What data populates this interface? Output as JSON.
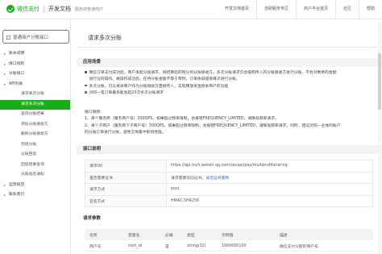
{
  "header": {
    "logo_text": "微信支付",
    "doc_title": "开发文档",
    "sub_title": "服务商普通商户",
    "nav": [
      "开发文档首页",
      "自助服务专区",
      "商户平台首页",
      "社区",
      "帮助"
    ]
  },
  "sidebar": {
    "title": "普通商户分账接口",
    "items": [
      {
        "label": "账本说明",
        "arrow": "▸",
        "level": 1
      },
      {
        "label": "接口规则",
        "arrow": "▸",
        "level": 1
      },
      {
        "label": "分账接口",
        "arrow": "▸",
        "level": 1
      },
      {
        "label": "API列表",
        "arrow": "▾",
        "level": 1
      },
      {
        "label": "请求单次分账",
        "level": 2
      },
      {
        "label": "请求多次分账",
        "level": 2,
        "active": true
      },
      {
        "label": "查询分账结果",
        "level": 2
      },
      {
        "label": "添加分账接收方",
        "level": 2
      },
      {
        "label": "删除分账接收方",
        "level": 2
      },
      {
        "label": "完结分账",
        "level": 2
      },
      {
        "label": "分账回退",
        "level": 2
      },
      {
        "label": "回退结果查询",
        "level": 2
      },
      {
        "label": "分账动态通知",
        "level": 2
      },
      {
        "label": "运营规范",
        "arrow": "▸",
        "level": 1
      },
      {
        "label": "联系我们",
        "arrow": "▸",
        "level": 1
      }
    ]
  },
  "main": {
    "page_title": "请求多次分账",
    "sec_scene": "应用场景",
    "scene_lines": [
      "微信订单支付成功后，商户发起分账请求，将结算后的钱分到分账接收方。多次分账请求仅会按照传入的分账接收方进行分账，不会对剩余的金额",
      "进行任何操作。故操作成功后，在待分账金额不等于零时，订单依旧能够再次进行分账。",
      "多次分账，可以将本商户作为分账接收方直接传入，实现释放资金给本商户的功能",
      "对同一笔订单最多能发起20次多次分账请求"
    ],
    "limit_lines": [
      "接口限频：",
      "1、单个服务商（服务商户号）300QPS，如果超过频率限制，会报错FREQUENCY_LIMITED，请降低频率请求。",
      "2、单个子商户（服务商下子商户号）300QPS，如果超过频率限制，会报错FREQUENCY_LIMITED，请降低频率请求。同时，建议对同一主体的账户",
      "的分账订单进行分账，避免交易集中影响性能。"
    ],
    "sec_api": "接口说明",
    "api_rows": [
      {
        "k": "请求Url",
        "v": "https://api.mch.weixin.qq.com/secapi/pay/multiprofitsharing"
      },
      {
        "k": "是否需要证书",
        "v": "请求需要双向证书。",
        "link": "详见证书使用"
      },
      {
        "k": "请求方式",
        "v": "post"
      },
      {
        "k": "签名方式",
        "v": "HMAC-SHA256"
      }
    ],
    "sec_params": "请求参数",
    "param_headers": [
      "名称",
      "变量名",
      "必填",
      "类型",
      "示例值",
      "描述"
    ],
    "param_rows": [
      [
        "商户号",
        "mch_id",
        "是",
        "string(32)",
        "1900000100",
        "微信支付分配的商户号"
      ]
    ]
  }
}
